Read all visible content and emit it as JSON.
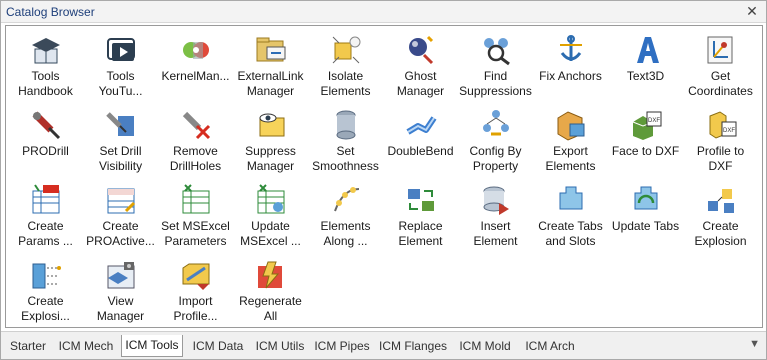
{
  "window": {
    "title": "Catalog Browser",
    "close_glyph": "✕"
  },
  "tools": [
    {
      "label": "Tools\nHandbook",
      "icon": "handbook-icon"
    },
    {
      "label": "Tools\nYouTu...",
      "icon": "youtube-icon"
    },
    {
      "label": "KernelMan...",
      "icon": "kernel-manager-icon"
    },
    {
      "label": "ExternalLink\nManager",
      "icon": "external-link-icon"
    },
    {
      "label": "Isolate\nElements",
      "icon": "isolate-icon"
    },
    {
      "label": "Ghost\nManager",
      "icon": "ghost-icon"
    },
    {
      "label": "Find\nSuppressions",
      "icon": "find-suppressions-icon"
    },
    {
      "label": "Fix Anchors",
      "icon": "fix-anchors-icon"
    },
    {
      "label": "Text3D",
      "icon": "text3d-icon"
    },
    {
      "label": "Get\nCoordinates",
      "icon": "get-coordinates-icon"
    },
    {
      "label": "PRODrill",
      "icon": "prodrill-icon"
    },
    {
      "label": "Set Drill\nVisibility",
      "icon": "drill-visibility-icon"
    },
    {
      "label": "Remove\nDrillHoles",
      "icon": "remove-drillholes-icon"
    },
    {
      "label": "Suppress\nManager",
      "icon": "suppress-manager-icon"
    },
    {
      "label": "Set\nSmoothness",
      "icon": "smoothness-icon"
    },
    {
      "label": "DoubleBend",
      "icon": "double-bend-icon"
    },
    {
      "label": "Config By\nProperty",
      "icon": "config-property-icon"
    },
    {
      "label": "Export\nElements",
      "icon": "export-elements-icon"
    },
    {
      "label": "Face to DXF",
      "icon": "face-dxf-icon"
    },
    {
      "label": "Profile to\nDXF",
      "icon": "profile-dxf-icon"
    },
    {
      "label": "Create\nParams ...",
      "icon": "create-params-icon"
    },
    {
      "label": "Create\nPROActive...",
      "icon": "proactive-icon"
    },
    {
      "label": "Set MSExcel\nParameters",
      "icon": "excel-params-icon"
    },
    {
      "label": "Update\nMSExcel ...",
      "icon": "update-excel-icon"
    },
    {
      "label": "Elements\nAlong ...",
      "icon": "elements-along-icon"
    },
    {
      "label": "Replace\nElement",
      "icon": "replace-element-icon"
    },
    {
      "label": "Insert\nElement",
      "icon": "insert-element-icon"
    },
    {
      "label": "Create Tabs\nand Slots",
      "icon": "tabs-slots-icon"
    },
    {
      "label": "Update Tabs",
      "icon": "update-tabs-icon"
    },
    {
      "label": "Create\nExplosion",
      "icon": "explosion-icon"
    },
    {
      "label": "Create\nExplosi...",
      "icon": "explosion-lines-icon"
    },
    {
      "label": "View\nManager",
      "icon": "view-manager-icon"
    },
    {
      "label": "Import\nProfile...",
      "icon": "import-profile-icon"
    },
    {
      "label": "Regenerate\nAll",
      "icon": "regenerate-icon"
    }
  ],
  "tabs": [
    {
      "label": "Starter",
      "active": false
    },
    {
      "label": "ICM Mech",
      "active": false
    },
    {
      "label": "ICM Tools",
      "active": true
    },
    {
      "label": "ICM Data",
      "active": false
    },
    {
      "label": "ICM Utils",
      "active": false
    },
    {
      "label": "ICM Pipes",
      "active": false
    },
    {
      "label": "ICM Flanges",
      "active": false
    },
    {
      "label": "ICM Mold",
      "active": false
    },
    {
      "label": "ICM Arch",
      "active": false
    }
  ],
  "tab_menu_glyph": "▼"
}
